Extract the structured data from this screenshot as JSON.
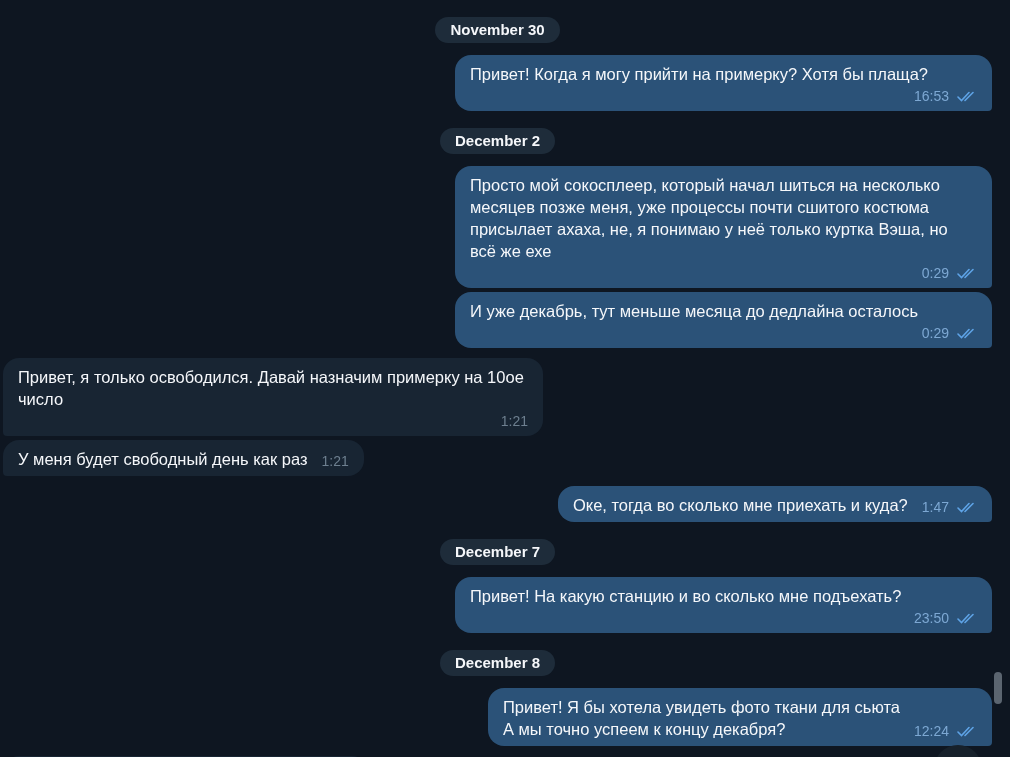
{
  "messages": [
    {
      "kind": "date",
      "text": "November 30"
    },
    {
      "kind": "message",
      "outgoing": true,
      "text": "Привет! Когда я могу прийти на примерку? Хотя бы плаща?",
      "time": "16:53",
      "read": true
    },
    {
      "kind": "date",
      "text": "December 2"
    },
    {
      "kind": "message",
      "outgoing": true,
      "text": "Просто мой сокосплеер, который начал шиться на несколько месяцев позже меня, уже процессы почти сшитого костюма присылает ахаха, не, я понимаю у неё только куртка Вэша, но всё же ехе",
      "time": "0:29",
      "read": true
    },
    {
      "kind": "message",
      "outgoing": true,
      "text": "И уже декабрь, тут меньше месяца до дедлайна осталось",
      "time": "0:29",
      "read": true
    },
    {
      "kind": "message",
      "outgoing": false,
      "text": "Привет, я только освободился. Давай назначим примерку на 10ое число",
      "time": "1:21"
    },
    {
      "kind": "message",
      "outgoing": false,
      "text": "У меня будет свободный день как раз",
      "time": "1:21"
    },
    {
      "kind": "message",
      "outgoing": true,
      "text": "Оке, тогда во сколько мне приехать и куда?",
      "time": "1:47",
      "read": true
    },
    {
      "kind": "date",
      "text": "December 7"
    },
    {
      "kind": "message",
      "outgoing": true,
      "text": "Привет! На какую станцию и во сколько мне подъехать?",
      "time": "23:50",
      "read": true
    },
    {
      "kind": "date",
      "text": "December 8"
    },
    {
      "kind": "message",
      "outgoing": true,
      "text": "Привет! Я бы хотела увидеть фото ткани для сьюта\nА мы точно успеем к концу декабря?",
      "time": "12:24",
      "read": true
    }
  ]
}
